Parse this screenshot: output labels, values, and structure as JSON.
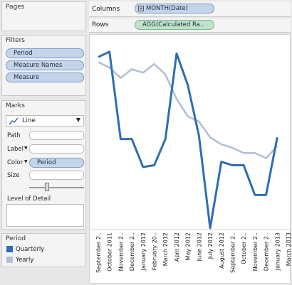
{
  "pages": {
    "title": "Pages"
  },
  "filters": {
    "title": "Filters",
    "items": [
      "Period",
      "Measure Names",
      "Measure"
    ]
  },
  "marks": {
    "title": "Marks",
    "mark_type": "Line",
    "path_label": "Path",
    "label_label": "Label",
    "color_label": "Color",
    "color_pill": "Period",
    "size_label": "Size",
    "level_of_detail": "Level of Detail"
  },
  "legend": {
    "title": "Period",
    "items": [
      {
        "label": "Quarterly",
        "color": "#2e6db4"
      },
      {
        "label": "Yearly",
        "color": "#b3bfd9"
      }
    ]
  },
  "shelves": {
    "columns_label": "Columns",
    "columns_pill": "MONTH(Date)",
    "rows_label": "Rows",
    "rows_pill": "AGG(Calculated Ra.."
  },
  "chart_data": {
    "type": "line",
    "categories": [
      "September 2..",
      "October 2011",
      "November 2..",
      "December 2..",
      "January 2012",
      "February 20..",
      "March 2012",
      "April 2012",
      "May 2012",
      "June 2012",
      "July 2012",
      "August 2012",
      "September 2..",
      "October 2..",
      "November 2..",
      "December 2..",
      "January 2013",
      "March 2013"
    ],
    "series": [
      {
        "name": "Quarterly",
        "color": "#2e6db4",
        "values": [
          0.93,
          0.96,
          0.46,
          0.46,
          0.3,
          0.31,
          0.46,
          0.95,
          0.77,
          0.48,
          -0.05,
          0.33,
          0.31,
          0.31,
          0.14,
          0.14,
          0.47,
          null
        ]
      },
      {
        "name": "Yearly",
        "color": "#b3bfd9",
        "values": [
          0.9,
          0.87,
          0.81,
          0.86,
          0.84,
          0.89,
          0.83,
          0.69,
          0.59,
          0.56,
          0.47,
          0.43,
          0.41,
          0.38,
          0.38,
          0.35,
          0.42,
          null
        ]
      }
    ],
    "ylim": [
      -0.05,
      1.0
    ],
    "grid": false
  }
}
